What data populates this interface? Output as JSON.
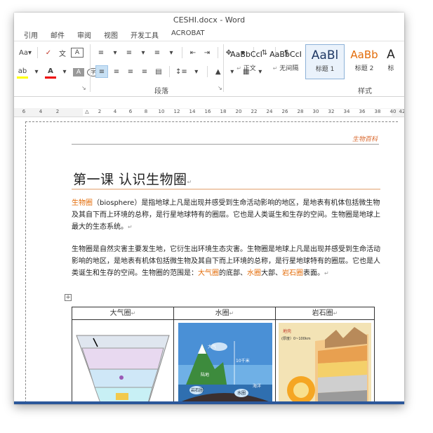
{
  "window": {
    "title": "CESHI.docx - Word"
  },
  "menu": [
    "引用",
    "邮件",
    "审阅",
    "视图",
    "开发工具",
    "ACROBAT"
  ],
  "ribbon": {
    "font_size_btn": "Aa",
    "paragraph_group_label": "段落",
    "styles_group_label": "样式",
    "styles": [
      {
        "sample": "AaBbCcI",
        "name": "正文"
      },
      {
        "sample": "AaBbCcI",
        "name": "无间隔"
      },
      {
        "sample": "AaBl",
        "name": "标题 1"
      },
      {
        "sample": "AaBb",
        "name": "标题 2"
      },
      {
        "sample": "A",
        "name": "标"
      }
    ]
  },
  "ruler": {
    "ticks": [
      "6",
      "4",
      "2",
      "",
      "2",
      "4",
      "6",
      "8",
      "10",
      "12",
      "14",
      "16",
      "18",
      "20",
      "22",
      "24",
      "26",
      "28",
      "30",
      "32",
      "34",
      "36",
      "38",
      "40",
      "42"
    ]
  },
  "document": {
    "header_text": "生物百科",
    "title": "第一课 认识生物圈",
    "para1_term": "生物圈",
    "para1_rest": "（biosphere）是指地球上凡是出现并感受到生命活动影响的地区，是地表有机体包括微生物及其自下而上环境的总称，是行星地球特有的圈层。它也是人类诞生和生存的空间。生物圈是地球上最大的生态系统。",
    "para2_a": "生物圈是自然灾害主要发生地，它衍生出环境生态灾害。生物圈是地球上凡是出现并感受到生命活动影响的地区，是地表有机体包括微生物及其自下而上环境的总称，是行星地球特有的圈层。它也是人类诞生和生存的空间。生物圈的范围是：",
    "para2_atm": "大气圈",
    "para2_b": "的底部、",
    "para2_hyd": "水圈",
    "para2_c": "大部、",
    "para2_lith": "岩石圈",
    "para2_d": "表面。",
    "table_headers": [
      "大气圈",
      "水圈",
      "岩石圈"
    ],
    "water_labels": {
      "atm": "大气",
      "land": "陆地",
      "rock": "岩石圈",
      "water": "水圈",
      "sea": "海洋",
      "height": "10千米"
    },
    "earth_labels": {
      "crust": "地壳",
      "thickness": "(厚度）0~100km"
    }
  },
  "colors": {
    "accent": "#2b579a",
    "orange": "#e36c09",
    "header_orange": "#d9692f"
  }
}
